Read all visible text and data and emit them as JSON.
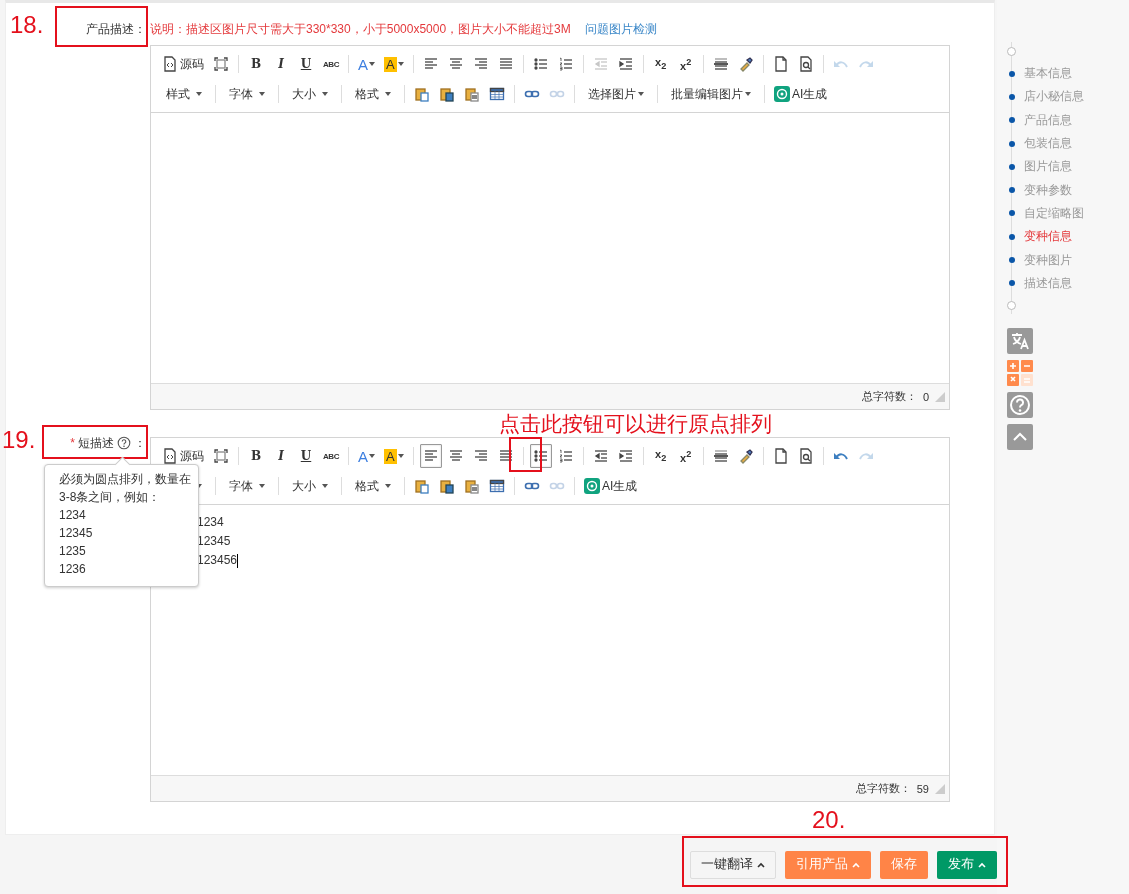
{
  "annotations": [
    {
      "number": "18."
    },
    {
      "number": "19."
    },
    {
      "number": "20."
    }
  ],
  "callout": "点击此按钮可以进行原点排列",
  "description": {
    "label": "产品描述：",
    "notice": "说明：描述区图片尺寸需大于330*330，小于5000x5000，图片大小不能超过3M",
    "notice_link": "问题图片检测",
    "editor": {
      "toolbar": [
        [
          [
            {
              "kind": "source",
              "label": "源码",
              "selected": false,
              "disabled": false
            },
            {
              "kind": "fullscreen",
              "selected": false,
              "disabled": false
            }
          ],
          [
            {
              "kind": "bold",
              "label": "B",
              "selected": false,
              "disabled": false
            },
            {
              "kind": "italic",
              "label": "I",
              "selected": false,
              "disabled": false
            },
            {
              "kind": "underline",
              "label": "U",
              "selected": false,
              "disabled": false
            },
            {
              "kind": "strike",
              "label": "ABC",
              "selected": false,
              "disabled": false
            }
          ],
          [
            {
              "kind": "fontcolor",
              "label": "A",
              "selected": false,
              "disabled": false
            },
            {
              "kind": "highlight",
              "label": "A",
              "selected": false,
              "disabled": false
            }
          ],
          [
            {
              "kind": "alignleft",
              "selected": false,
              "disabled": false
            },
            {
              "kind": "aligncenter",
              "selected": false,
              "disabled": false
            },
            {
              "kind": "alignright",
              "selected": false,
              "disabled": false
            },
            {
              "kind": "justify",
              "selected": false,
              "disabled": false
            }
          ],
          [
            {
              "kind": "bullets",
              "selected": false,
              "disabled": false
            },
            {
              "kind": "numbers",
              "selected": false,
              "disabled": false
            }
          ],
          [
            {
              "kind": "outdent",
              "selected": false,
              "disabled": true
            },
            {
              "kind": "indent",
              "selected": false,
              "disabled": false
            }
          ],
          [
            {
              "kind": "subscript",
              "label": "x$_{2}$",
              "selected": false,
              "disabled": false
            },
            {
              "kind": "superscript",
              "label": "x$^{2}$",
              "selected": false,
              "disabled": false
            }
          ],
          [
            {
              "kind": "rule",
              "selected": false,
              "disabled": false
            },
            {
              "kind": "painter",
              "selected": false,
              "disabled": false
            }
          ],
          [
            {
              "kind": "newdoc",
              "selected": false,
              "disabled": false
            },
            {
              "kind": "preview",
              "selected": false,
              "disabled": false
            }
          ],
          [
            {
              "kind": "undo",
              "selected": false,
              "disabled": true
            },
            {
              "kind": "redo",
              "selected": false,
              "disabled": true
            }
          ]
        ],
        [
          [
            {
              "kind": "dropdown",
              "label": "样式",
              "selected": false,
              "disabled": false
            }
          ],
          [
            {
              "kind": "dropdown",
              "label": "字体",
              "selected": false,
              "disabled": false
            }
          ],
          [
            {
              "kind": "dropdown",
              "label": "大小",
              "selected": false,
              "disabled": false
            }
          ],
          [
            {
              "kind": "dropdown",
              "label": "格式",
              "selected": false,
              "disabled": false
            }
          ],
          [
            {
              "kind": "paste",
              "selected": false,
              "disabled": false
            },
            {
              "kind": "pasteword",
              "selected": false,
              "disabled": false
            },
            {
              "kind": "pastetext",
              "selected": false,
              "disabled": false
            },
            {
              "kind": "table",
              "selected": false,
              "disabled": false
            }
          ],
          [
            {
              "kind": "link",
              "selected": false,
              "disabled": false
            },
            {
              "kind": "unlink",
              "selected": false,
              "disabled": true
            }
          ],
          [
            {
              "kind": "dropdown",
              "label": "选择图片",
              "selected": false,
              "disabled": false
            }
          ],
          [
            {
              "kind": "dropdown",
              "label": "批量编辑图片",
              "selected": false,
              "disabled": false
            }
          ],
          [
            {
              "kind": "ai",
              "label": "AI生成",
              "selected": false,
              "disabled": false
            }
          ]
        ]
      ],
      "counter_label": "总字符数：",
      "counter_value": "0"
    }
  },
  "short_description": {
    "required_mark": "*",
    "label": "短描述",
    "colon": "：",
    "tooltip": {
      "intro": "必须为圆点排列，数量在3-8条之间，例如：",
      "examples": [
        "1234",
        "12345",
        "1235",
        "1236"
      ]
    },
    "editor": {
      "toolbar": [
        [
          [
            {
              "kind": "source",
              "label": "源码",
              "selected": false,
              "disabled": false
            },
            {
              "kind": "fullscreen",
              "selected": false,
              "disabled": false
            }
          ],
          [
            {
              "kind": "bold",
              "label": "B",
              "selected": false,
              "disabled": false
            },
            {
              "kind": "italic",
              "label": "I",
              "selected": false,
              "disabled": false
            },
            {
              "kind": "underline",
              "label": "U",
              "selected": false,
              "disabled": false
            },
            {
              "kind": "strike",
              "label": "ABC",
              "selected": false,
              "disabled": false
            }
          ],
          [
            {
              "kind": "fontcolor",
              "label": "A",
              "selected": false,
              "disabled": false
            },
            {
              "kind": "highlight",
              "label": "A",
              "selected": false,
              "disabled": false
            }
          ],
          [
            {
              "kind": "alignleft",
              "selected": true,
              "disabled": false
            },
            {
              "kind": "aligncenter",
              "selected": false,
              "disabled": false
            },
            {
              "kind": "alignright",
              "selected": false,
              "disabled": false
            },
            {
              "kind": "justify",
              "selected": false,
              "disabled": false
            }
          ],
          [
            {
              "kind": "bullets",
              "selected": true,
              "disabled": false
            },
            {
              "kind": "numbers",
              "selected": false,
              "disabled": false
            }
          ],
          [
            {
              "kind": "outdent",
              "selected": false,
              "disabled": false
            },
            {
              "kind": "indent",
              "selected": false,
              "disabled": false
            }
          ],
          [
            {
              "kind": "subscript",
              "label": "x$_{2}$",
              "selected": false,
              "disabled": false
            },
            {
              "kind": "superscript",
              "label": "x$^{2}$",
              "selected": false,
              "disabled": false
            }
          ],
          [
            {
              "kind": "rule",
              "selected": false,
              "disabled": false
            },
            {
              "kind": "painter",
              "selected": false,
              "disabled": false
            }
          ],
          [
            {
              "kind": "newdoc",
              "selected": false,
              "disabled": false
            },
            {
              "kind": "preview",
              "selected": false,
              "disabled": false
            }
          ],
          [
            {
              "kind": "undo",
              "selected": false,
              "disabled": false
            },
            {
              "kind": "redo",
              "selected": false,
              "disabled": true
            }
          ]
        ],
        [
          [
            {
              "kind": "dropdown",
              "selected": false,
              "disabled": false
            }
          ],
          [
            {
              "kind": "dropdown",
              "label": "字体",
              "selected": false,
              "disabled": false
            }
          ],
          [
            {
              "kind": "dropdown",
              "label": "大小",
              "selected": false,
              "disabled": false
            }
          ],
          [
            {
              "kind": "dropdown",
              "label": "格式",
              "selected": false,
              "disabled": false
            }
          ],
          [
            {
              "kind": "paste",
              "selected": false,
              "disabled": false
            },
            {
              "kind": "pasteword",
              "selected": false,
              "disabled": false
            },
            {
              "kind": "pastetext",
              "selected": false,
              "disabled": false
            },
            {
              "kind": "table",
              "selected": false,
              "disabled": false
            }
          ],
          [
            {
              "kind": "link",
              "selected": false,
              "disabled": false
            },
            {
              "kind": "unlink",
              "selected": false,
              "disabled": true
            }
          ],
          [
            {
              "kind": "ai",
              "label": "AI生成",
              "selected": false,
              "disabled": false
            }
          ]
        ]
      ],
      "lines": [
        "1234",
        "12345",
        "123456"
      ],
      "counter_label": "总字符数：",
      "counter_value": "59"
    }
  },
  "sidebar": {
    "items": [
      {
        "label": "基本信息",
        "selected": false
      },
      {
        "label": "店小秘信息",
        "selected": false
      },
      {
        "label": "产品信息",
        "selected": false
      },
      {
        "label": "包装信息",
        "selected": false
      },
      {
        "label": "图片信息",
        "selected": false
      },
      {
        "label": "变种参数",
        "selected": false
      },
      {
        "label": "自定缩略图",
        "selected": false
      },
      {
        "label": "变种信息",
        "selected": true
      },
      {
        "label": "变种图片",
        "selected": false
      },
      {
        "label": "描述信息",
        "selected": false
      }
    ],
    "tools": [
      {
        "kind": "translate"
      },
      {
        "kind": "calculator"
      },
      {
        "kind": "help"
      },
      {
        "kind": "top"
      }
    ]
  },
  "actions": [
    {
      "label": "一键翻译",
      "kind": "default",
      "dropdown": true
    },
    {
      "label": "引用产品",
      "kind": "orange",
      "dropdown": true
    },
    {
      "label": "保存",
      "kind": "orange",
      "dropdown": false
    },
    {
      "label": "发布",
      "kind": "green",
      "dropdown": true
    }
  ]
}
